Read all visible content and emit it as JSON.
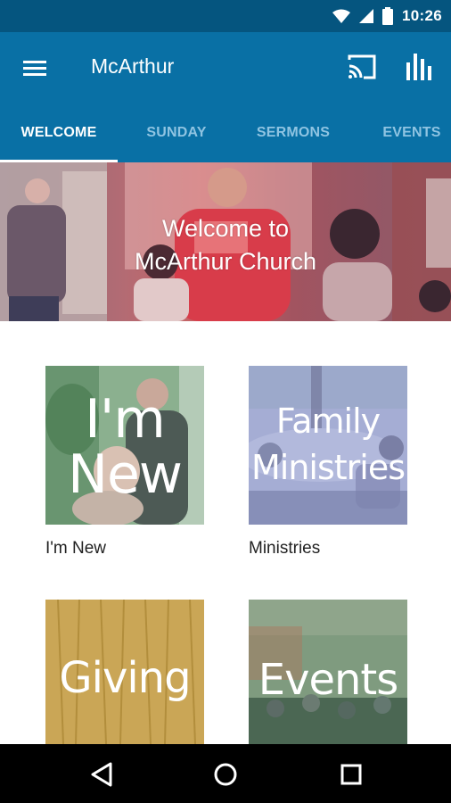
{
  "status_bar": {
    "time": "10:26",
    "icons": [
      "wifi-icon",
      "cell-signal-icon",
      "battery-icon"
    ]
  },
  "app_bar": {
    "title": "McArthur",
    "icons": [
      "menu-icon",
      "cast-icon",
      "bar-chart-icon"
    ]
  },
  "tabs": [
    {
      "label": "WELCOME",
      "active": true
    },
    {
      "label": "SUNDAY",
      "active": false
    },
    {
      "label": "SERMONS",
      "active": false
    },
    {
      "label": "EVENTS",
      "active": false
    }
  ],
  "hero": {
    "line1": "Welcome to",
    "line2": "McArthur Church"
  },
  "tiles": [
    {
      "image_line1": "I'm",
      "image_line2": "New",
      "label": "I'm New"
    },
    {
      "image_line1": "Family",
      "image_line2": "Ministries",
      "label": "Ministries"
    },
    {
      "image_line1": "Giving",
      "label": ""
    },
    {
      "image_line1": "Events",
      "label": ""
    }
  ],
  "nav_bar": {
    "icons": [
      "back-icon",
      "home-icon",
      "recents-icon"
    ]
  },
  "colors": {
    "status_bar": "#05557f",
    "app_bar": "#0970a5",
    "tab_inactive": "#8fc4e2",
    "tab_active": "#ffffff"
  }
}
